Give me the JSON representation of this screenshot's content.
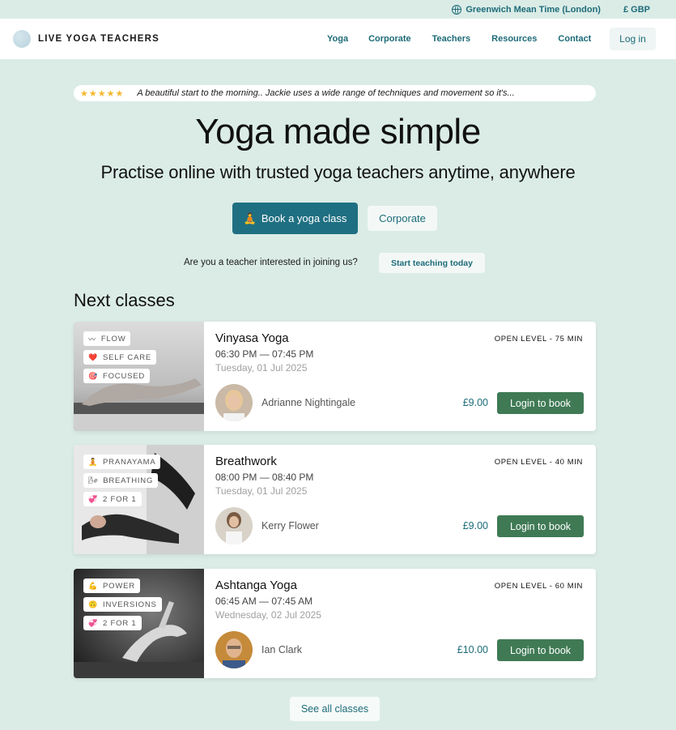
{
  "topbar": {
    "timezone": "Greenwich Mean Time (London)",
    "currency": "£ GBP"
  },
  "nav": {
    "brand": "LIVE YOGA TEACHERS",
    "links": [
      "Yoga",
      "Corporate",
      "Teachers",
      "Resources",
      "Contact"
    ],
    "login": "Log in"
  },
  "review": {
    "stars": "★★★★★",
    "text": "A beautiful start to the morning.. Jackie uses a wide range of techniques and movement so it's..."
  },
  "hero": {
    "title": "Yoga made simple",
    "subtitle": "Practise online with trusted yoga teachers anytime, anywhere",
    "book_icon": "🧘",
    "book_label": "Book a yoga class",
    "corporate_label": "Corporate"
  },
  "teacher_cta": {
    "question": "Are you a teacher interested in joining us?",
    "button": "Start teaching today"
  },
  "next_classes": {
    "title": "Next classes",
    "classes": [
      {
        "tags": [
          {
            "icon": "〰",
            "label": "FLOW"
          },
          {
            "icon": "❤️",
            "label": "SELF CARE"
          },
          {
            "icon": "🎯",
            "label": "FOCUSED"
          }
        ],
        "title": "Vinyasa Yoga",
        "time": "06:30 PM — 07:45 PM",
        "date": "Tuesday, 01 Jul 2025",
        "level": "OPEN LEVEL - 75 MIN",
        "teacher": "Adrianne Nightingale",
        "price": "£9.00",
        "book": "Login to book"
      },
      {
        "tags": [
          {
            "icon": "🧘",
            "label": "PRANAYAMA"
          },
          {
            "icon": "🌬",
            "label": "BREATHING"
          },
          {
            "icon": "💞",
            "label": "2 FOR 1"
          }
        ],
        "title": "Breathwork",
        "time": "08:00 PM — 08:40 PM",
        "date": "Tuesday, 01 Jul 2025",
        "level": "OPEN LEVEL - 40 MIN",
        "teacher": "Kerry Flower",
        "price": "£9.00",
        "book": "Login to book"
      },
      {
        "tags": [
          {
            "icon": "💪",
            "label": "POWER"
          },
          {
            "icon": "🙃",
            "label": "INVERSIONS"
          },
          {
            "icon": "💞",
            "label": "2 FOR 1"
          }
        ],
        "title": "Ashtanga Yoga",
        "time": "06:45 AM — 07:45 AM",
        "date": "Wednesday, 02 Jul 2025",
        "level": "OPEN LEVEL - 60 MIN",
        "teacher": "Ian Clark",
        "price": "£10.00",
        "book": "Login to book"
      }
    ],
    "see_all": "See all classes"
  }
}
